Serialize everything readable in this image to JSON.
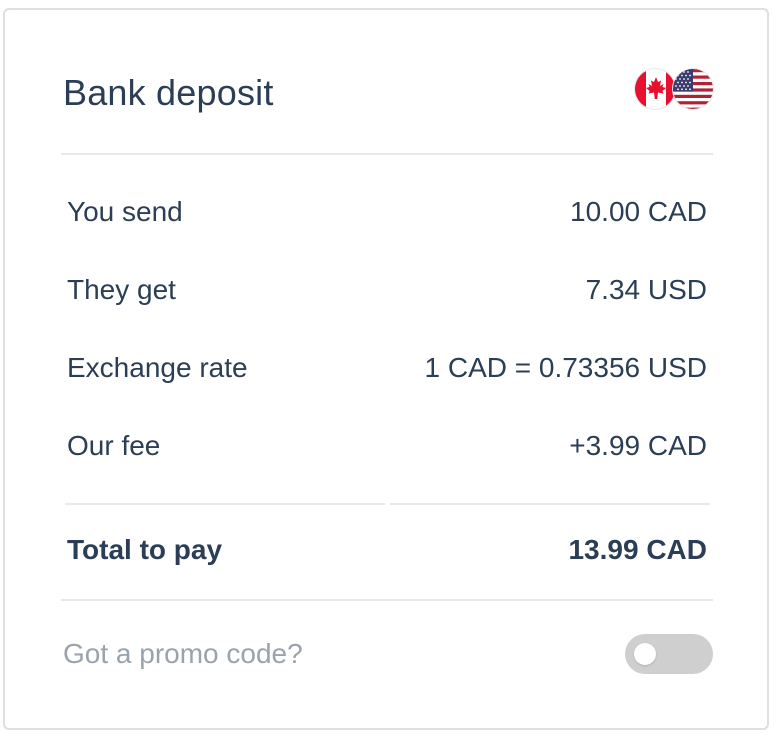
{
  "card": {
    "title": "Bank deposit",
    "flags": {
      "from": {
        "icon": "canada-flag-icon",
        "color": "#e8102e"
      },
      "to": {
        "icon": "usa-flag-icon",
        "color": "#b22234"
      }
    }
  },
  "summary": {
    "rows": [
      {
        "label": "You send",
        "value": "10.00 CAD"
      },
      {
        "label": "They get",
        "value": "7.34 USD"
      },
      {
        "label": "Exchange rate",
        "value": "1 CAD = 0.73356 USD"
      },
      {
        "label": "Our fee",
        "value": "+3.99 CAD"
      }
    ],
    "total": {
      "label": "Total to pay",
      "value": "13.99 CAD"
    }
  },
  "promo": {
    "label": "Got a promo code?",
    "toggle_on": false
  },
  "colors": {
    "text": "#2c3e55",
    "muted": "#9aa3ad",
    "border": "#dcdfe3",
    "toggle_off": "#cfcfcf"
  }
}
